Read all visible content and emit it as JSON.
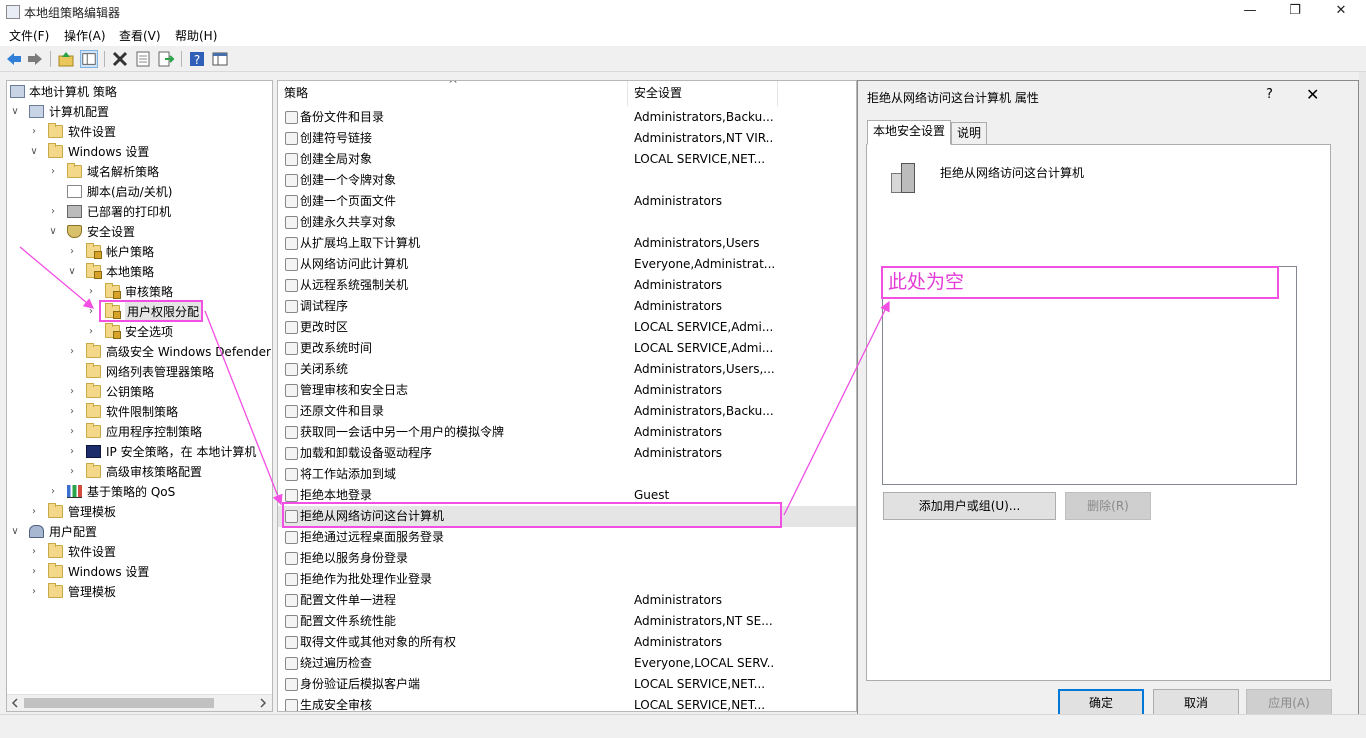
{
  "window": {
    "title": "本地组策略编辑器",
    "minimize": "—",
    "maximize": "❐",
    "close": "✕"
  },
  "menu": [
    "文件(F)",
    "操作(A)",
    "查看(V)",
    "帮助(H)"
  ],
  "toolbar_icons": [
    "back-icon",
    "forward-icon",
    "up-folder-icon",
    "show-hide-tree-icon",
    "delete-icon",
    "properties-icon",
    "export-icon",
    "help-icon",
    "console-icon"
  ],
  "tree": [
    {
      "label": "本地计算机 策略",
      "chev": ""
    },
    {
      "label": "计算机配置",
      "chev": "∨"
    },
    {
      "label": "软件设置",
      "chev": "›"
    },
    {
      "label": "Windows 设置",
      "chev": "∨"
    },
    {
      "label": "域名解析策略",
      "chev": "›"
    },
    {
      "label": "脚本(启动/关机)",
      "chev": ""
    },
    {
      "label": "已部署的打印机",
      "chev": "›"
    },
    {
      "label": "安全设置",
      "chev": "∨"
    },
    {
      "label": "帐户策略",
      "chev": "›"
    },
    {
      "label": "本地策略",
      "chev": "∨"
    },
    {
      "label": "审核策略",
      "chev": "›"
    },
    {
      "label": "用户权限分配",
      "chev": "›"
    },
    {
      "label": "安全选项",
      "chev": "›"
    },
    {
      "label": "高级安全 Windows Defender",
      "chev": "›"
    },
    {
      "label": "网络列表管理器策略",
      "chev": ""
    },
    {
      "label": "公钥策略",
      "chev": "›"
    },
    {
      "label": "软件限制策略",
      "chev": "›"
    },
    {
      "label": "应用程序控制策略",
      "chev": "›"
    },
    {
      "label": "IP 安全策略，在 本地计算机",
      "chev": "›"
    },
    {
      "label": "高级审核策略配置",
      "chev": "›"
    },
    {
      "label": "基于策略的 QoS",
      "chev": "›"
    },
    {
      "label": "管理模板",
      "chev": "›"
    },
    {
      "label": "用户配置",
      "chev": "∨"
    },
    {
      "label": "软件设置",
      "chev": "›"
    },
    {
      "label": "Windows 设置",
      "chev": "›"
    },
    {
      "label": "管理模板",
      "chev": "›"
    }
  ],
  "list": {
    "col_policy": "策略",
    "col_setting": "安全设置",
    "sort_glyph": "^",
    "rows": [
      {
        "name": "备份文件和目录",
        "value": "Administrators,Backu..."
      },
      {
        "name": "创建符号链接",
        "value": "Administrators,NT VIR..."
      },
      {
        "name": "创建全局对象",
        "value": "LOCAL SERVICE,NET..."
      },
      {
        "name": "创建一个令牌对象",
        "value": ""
      },
      {
        "name": "创建一个页面文件",
        "value": "Administrators"
      },
      {
        "name": "创建永久共享对象",
        "value": ""
      },
      {
        "name": "从扩展坞上取下计算机",
        "value": "Administrators,Users"
      },
      {
        "name": "从网络访问此计算机",
        "value": "Everyone,Administrat..."
      },
      {
        "name": "从远程系统强制关机",
        "value": "Administrators"
      },
      {
        "name": "调试程序",
        "value": "Administrators"
      },
      {
        "name": "更改时区",
        "value": "LOCAL SERVICE,Admi..."
      },
      {
        "name": "更改系统时间",
        "value": "LOCAL SERVICE,Admi..."
      },
      {
        "name": "关闭系统",
        "value": "Administrators,Users,..."
      },
      {
        "name": "管理审核和安全日志",
        "value": "Administrators"
      },
      {
        "name": "还原文件和目录",
        "value": "Administrators,Backu..."
      },
      {
        "name": "获取同一会话中另一个用户的模拟令牌",
        "value": "Administrators"
      },
      {
        "name": "加载和卸载设备驱动程序",
        "value": "Administrators"
      },
      {
        "name": "将工作站添加到域",
        "value": ""
      },
      {
        "name": "拒绝本地登录",
        "value": "Guest"
      },
      {
        "name": "拒绝从网络访问这台计算机",
        "value": ""
      },
      {
        "name": "拒绝通过远程桌面服务登录",
        "value": ""
      },
      {
        "name": "拒绝以服务身份登录",
        "value": ""
      },
      {
        "name": "拒绝作为批处理作业登录",
        "value": ""
      },
      {
        "name": "配置文件单一进程",
        "value": "Administrators"
      },
      {
        "name": "配置文件系统性能",
        "value": "Administrators,NT SE..."
      },
      {
        "name": "取得文件或其他对象的所有权",
        "value": "Administrators"
      },
      {
        "name": "绕过遍历检查",
        "value": "Everyone,LOCAL SERV..."
      },
      {
        "name": "身份验证后模拟客户端",
        "value": "LOCAL SERVICE,NET..."
      },
      {
        "name": "生成安全审核",
        "value": "LOCAL SERVICE,NET..."
      }
    ]
  },
  "dialog": {
    "title": "拒绝从网络访问这台计算机 属性",
    "help": "?",
    "close": "✕",
    "tab_local": "本地安全设置",
    "tab_explain": "说明",
    "policy_name": "拒绝从网络访问这台计算机",
    "add_button": "添加用户或组(U)...",
    "remove_button": "删除(R)",
    "ok_button": "确定",
    "cancel_button": "取消",
    "apply_button": "应用(A)"
  },
  "annotation": {
    "empty_note": "此处为空",
    "color": "#f24fe3"
  }
}
